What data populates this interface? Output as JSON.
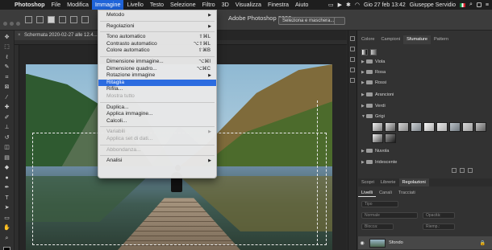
{
  "menubar": {
    "app": "Photoshop",
    "items": [
      "File",
      "Modifica",
      "Immagine",
      "Livello",
      "Testo",
      "Selezione",
      "Filtro",
      "3D",
      "Visualizza",
      "Finestra",
      "Aiuto"
    ],
    "active_item": "Immagine",
    "clock": "Gio 27 feb 13:42",
    "user": "Giuseppe Servidio"
  },
  "optionsbar": {
    "window_title": "Adobe Photoshop 2020",
    "select_mask_button": "Seleziona e maschera..."
  },
  "document": {
    "tab_title": "Schermata 2020-02-27 alle 12.4..."
  },
  "image_menu": {
    "items": [
      {
        "label": "Metodo",
        "submenu": true
      },
      {
        "separator": true
      },
      {
        "label": "Regolazioni",
        "submenu": true
      },
      {
        "separator": true
      },
      {
        "label": "Tono automatico",
        "shortcut": "⇧⌘L"
      },
      {
        "label": "Contrasto automatico",
        "shortcut": "⌥⇧⌘L"
      },
      {
        "label": "Colore automatico",
        "shortcut": "⇧⌘B"
      },
      {
        "separator": true
      },
      {
        "label": "Dimensione immagine...",
        "shortcut": "⌥⌘I"
      },
      {
        "label": "Dimensione quadro...",
        "shortcut": "⌥⌘C"
      },
      {
        "label": "Rotazione immagine",
        "submenu": true
      },
      {
        "label": "Ritaglia",
        "selected": true
      },
      {
        "label": "Rifila..."
      },
      {
        "label": "Mostra tutto",
        "disabled": true
      },
      {
        "separator": true
      },
      {
        "label": "Duplica..."
      },
      {
        "label": "Applica immagine..."
      },
      {
        "label": "Calcoli..."
      },
      {
        "separator": true
      },
      {
        "label": "Variabili",
        "submenu": true,
        "disabled": true
      },
      {
        "label": "Applica set di dati...",
        "disabled": true
      },
      {
        "separator": true
      },
      {
        "label": "Abbondanza...",
        "disabled": true
      },
      {
        "separator": true
      },
      {
        "label": "Analisi",
        "submenu": true
      }
    ]
  },
  "gradients_panel": {
    "tabs": [
      "Colore",
      "Campioni",
      "Sfumature",
      "Pattern"
    ],
    "active_tab": "Sfumature",
    "groups": [
      "Viola",
      "Rosa",
      "Rossi",
      "Arancioni",
      "Verdi",
      "Grigi",
      "Nuvola",
      "Iridescente"
    ]
  },
  "layers_panel": {
    "top_tabs": [
      "Scopri",
      "Librerie",
      "Regolazioni"
    ],
    "active_top_tab": "Regolazioni",
    "tabs": [
      "Livelli",
      "Canali",
      "Tracciati"
    ],
    "active_tab": "Livelli",
    "kind_label": "Tipo",
    "blend_mode": "Normale",
    "opacity_label": "Opacità:",
    "fill_label": "Riemp.:",
    "lock_label": "Blocca:",
    "layer_name": "Sfondo"
  },
  "colors": {
    "menu_highlight": "#2c6ce0",
    "menubar_active": "#1f64d9"
  }
}
